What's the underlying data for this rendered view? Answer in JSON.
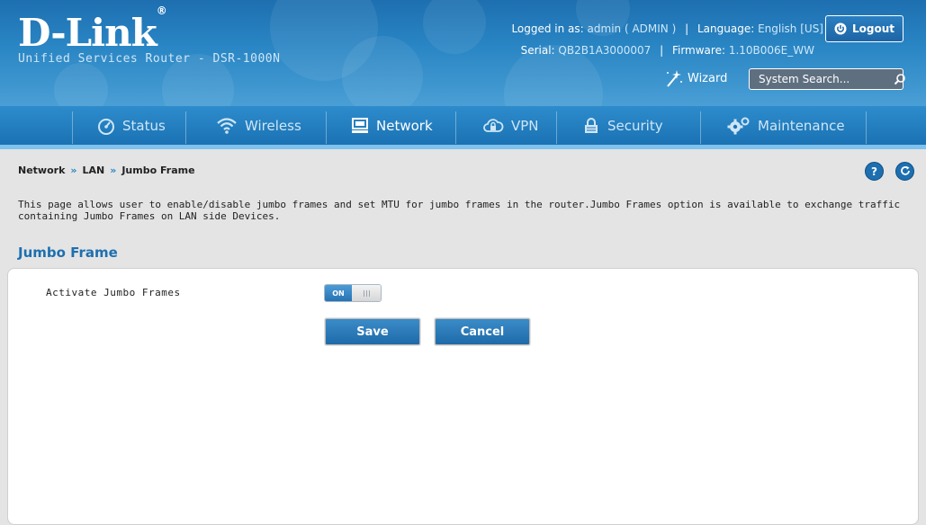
{
  "header": {
    "logo_text": "D-Link",
    "logo_mark": "®",
    "product_name": "Unified Services Router - DSR-1000N",
    "logged_in_label": "Logged in as:",
    "logged_in_value": "admin ( ADMIN )",
    "language_label": "Language:",
    "language_value": "English [US]",
    "serial_label": "Serial:",
    "serial_value": "QB2B1A3000007",
    "firmware_label": "Firmware:",
    "firmware_value": "1.10B006E_WW",
    "logout_label": "Logout",
    "wizard_label": "Wizard",
    "search_placeholder": "System Search...",
    "icons": [
      "power-icon",
      "wand-icon",
      "search-icon"
    ]
  },
  "nav": {
    "items": [
      {
        "label": "Status",
        "icon": "gauge-icon",
        "active": false
      },
      {
        "label": "Wireless",
        "icon": "wifi-icon",
        "active": false
      },
      {
        "label": "Network",
        "icon": "monitor-icon",
        "active": true
      },
      {
        "label": "VPN",
        "icon": "cloud-lock-icon",
        "active": false
      },
      {
        "label": "Security",
        "icon": "lock-icon",
        "active": false
      },
      {
        "label": "Maintenance",
        "icon": "gears-icon",
        "active": false
      }
    ]
  },
  "breadcrumb": [
    "Network",
    "LAN",
    "Jumbo Frame"
  ],
  "breadcrumb_separator": "»",
  "help_icon": "?",
  "intro_text": "This page allows user to enable/disable jumbo frames and set MTU for jumbo frames in the router.Jumbo Frames option is available to exchange traffic containing Jumbo Frames on LAN side Devices.",
  "section_title": "Jumbo Frame",
  "form": {
    "jumbo_label": "Activate Jumbo Frames",
    "toggle_state": "ON",
    "save_label": "Save",
    "cancel_label": "Cancel"
  },
  "colors": {
    "brand_blue": "#1d6fb0",
    "nav_blue": "#1a72b3",
    "accent_light": "#7fc2ee"
  }
}
